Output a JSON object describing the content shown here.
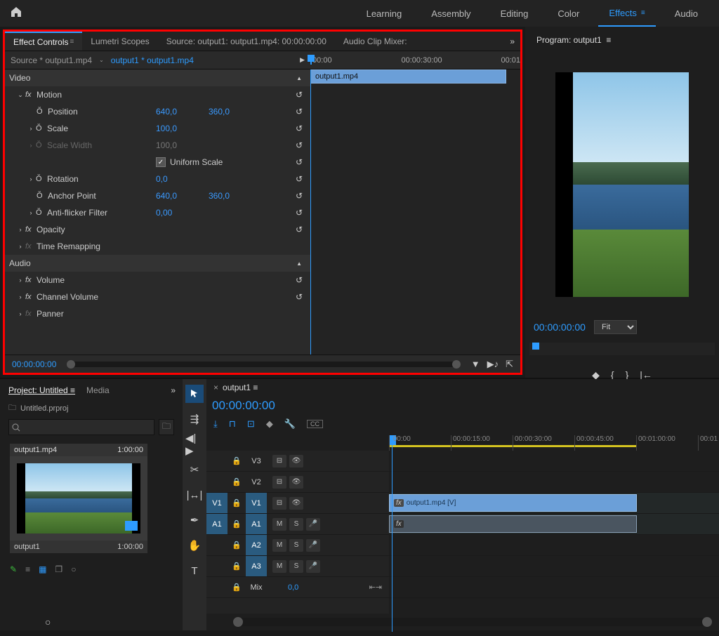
{
  "topbar": {
    "workspaces": [
      "Learning",
      "Assembly",
      "Editing",
      "Color",
      "Effects",
      "Audio"
    ],
    "active": "Effects"
  },
  "effectControls": {
    "tabs": {
      "effectControls": "Effect Controls",
      "lumetri": "Lumetri Scopes",
      "source": "Source: output1: output1.mp4: 00:00:00:00",
      "audioMixer": "Audio Clip Mixer:"
    },
    "sourceClip": "Source * output1.mp4",
    "sequenceClip": "output1 * output1.mp4",
    "rulerTicks": [
      ":00:00",
      "00:00:30:00",
      "00:01"
    ],
    "clipName": "output1.mp4",
    "videoHeader": "Video",
    "audioHeader": "Audio",
    "motion": {
      "label": "Motion",
      "position": {
        "label": "Position",
        "x": "640,0",
        "y": "360,0"
      },
      "scale": {
        "label": "Scale",
        "value": "100,0"
      },
      "scaleWidth": {
        "label": "Scale Width",
        "value": "100,0"
      },
      "uniformScale": {
        "label": "Uniform Scale",
        "checked": true
      },
      "rotation": {
        "label": "Rotation",
        "value": "0,0"
      },
      "anchor": {
        "label": "Anchor Point",
        "x": "640,0",
        "y": "360,0"
      },
      "antiFlicker": {
        "label": "Anti-flicker Filter",
        "value": "0,00"
      }
    },
    "opacity": {
      "label": "Opacity"
    },
    "timeRemap": {
      "label": "Time Remapping"
    },
    "volume": {
      "label": "Volume"
    },
    "channelVolume": {
      "label": "Channel Volume"
    },
    "panner": {
      "label": "Panner"
    },
    "timecode": "00:00:00:00"
  },
  "program": {
    "title": "Program: output1",
    "timecode": "00:00:00:00",
    "zoom": "Fit"
  },
  "project": {
    "tabs": {
      "project": "Project: Untitled",
      "media": "Media"
    },
    "projectName": "Untitled.prproj",
    "searchPlaceholder": "",
    "asset": {
      "name": "output1.mp4",
      "duration": "1:00:00",
      "seqName": "output1",
      "seqDur": "1:00:00"
    }
  },
  "sequence": {
    "name": "output1",
    "timecode": "00:00:00:00",
    "rulerTicks": [
      ":00:00",
      "00:00:15:00",
      "00:00:30:00",
      "00:00:45:00",
      "00:01:00:00",
      "00:01"
    ],
    "tracks": {
      "v3": "V3",
      "v2": "V2",
      "v1": "V1",
      "a1": "A1",
      "a2": "A2",
      "a3": "A3",
      "srcV1": "V1",
      "srcA1": "A1",
      "mix": "Mix",
      "mixVal": "0,0",
      "buttons": {
        "m": "M",
        "s": "S"
      }
    },
    "videoClip": "output1.mp4 [V]"
  }
}
